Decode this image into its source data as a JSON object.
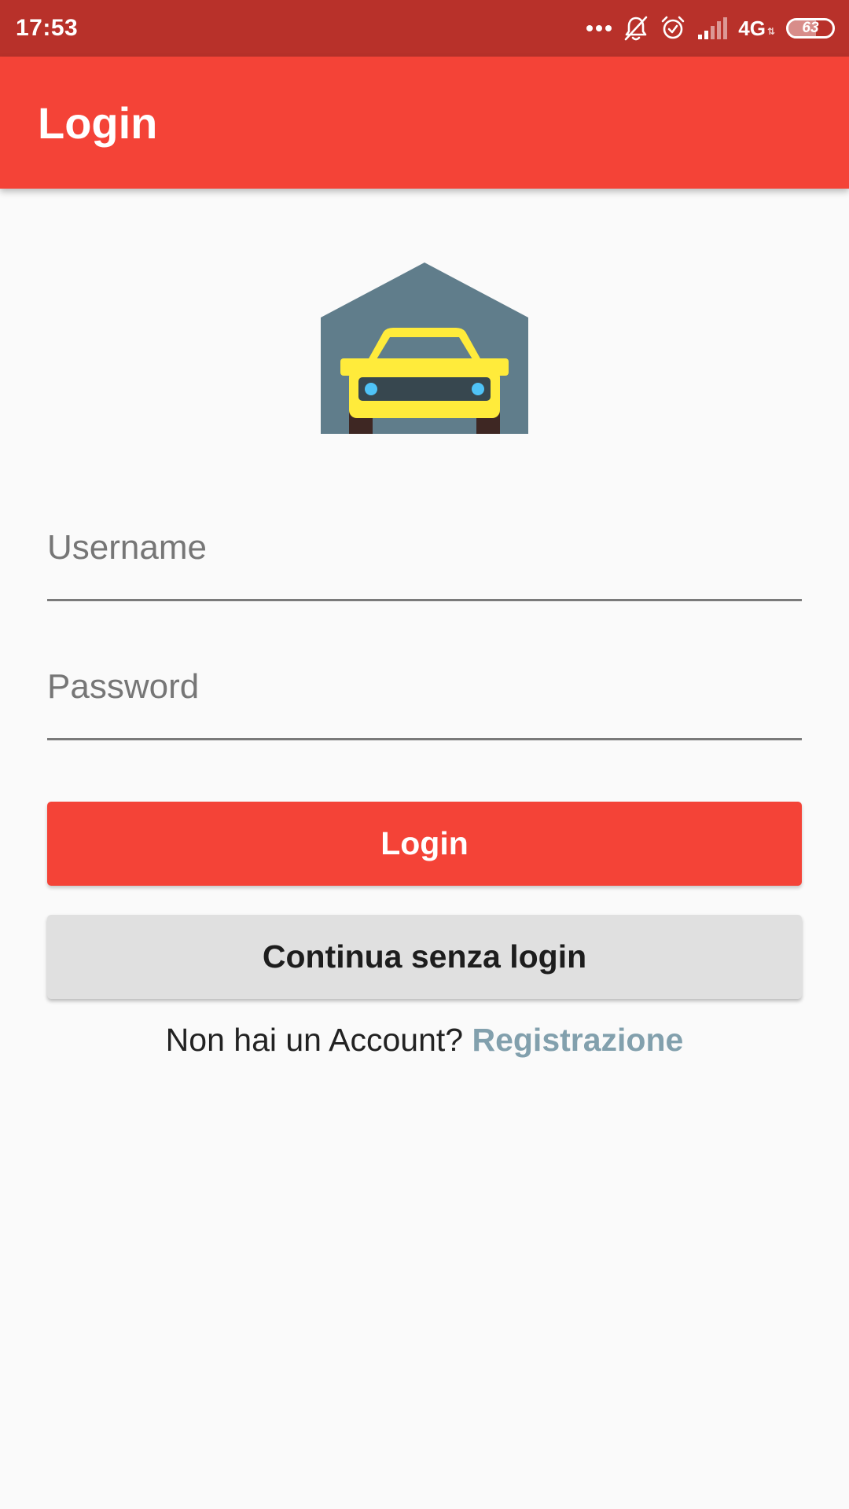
{
  "status_bar": {
    "time": "17:53",
    "network": "4G",
    "battery": "63",
    "battery_level": 0.63,
    "icons": [
      "more-dots-icon",
      "bell-off-icon",
      "alarm-icon",
      "signal-icon",
      "battery-icon"
    ]
  },
  "app_bar": {
    "title": "Login",
    "color": "#f44337"
  },
  "logo": {
    "icon": "garage-car-icon",
    "colors": {
      "garage": "#607d8b",
      "car": "#ffeb3b",
      "grille": "#37474f",
      "lights": "#4fc3f7"
    }
  },
  "form": {
    "username_placeholder": "Username",
    "username_value": "",
    "password_placeholder": "Password",
    "password_value": ""
  },
  "buttons": {
    "login_label": "Login",
    "guest_label": "Continua senza login"
  },
  "register": {
    "prompt": "Non hai un Account?",
    "link_label": "Registrazione",
    "link_color": "#82a0ad"
  }
}
